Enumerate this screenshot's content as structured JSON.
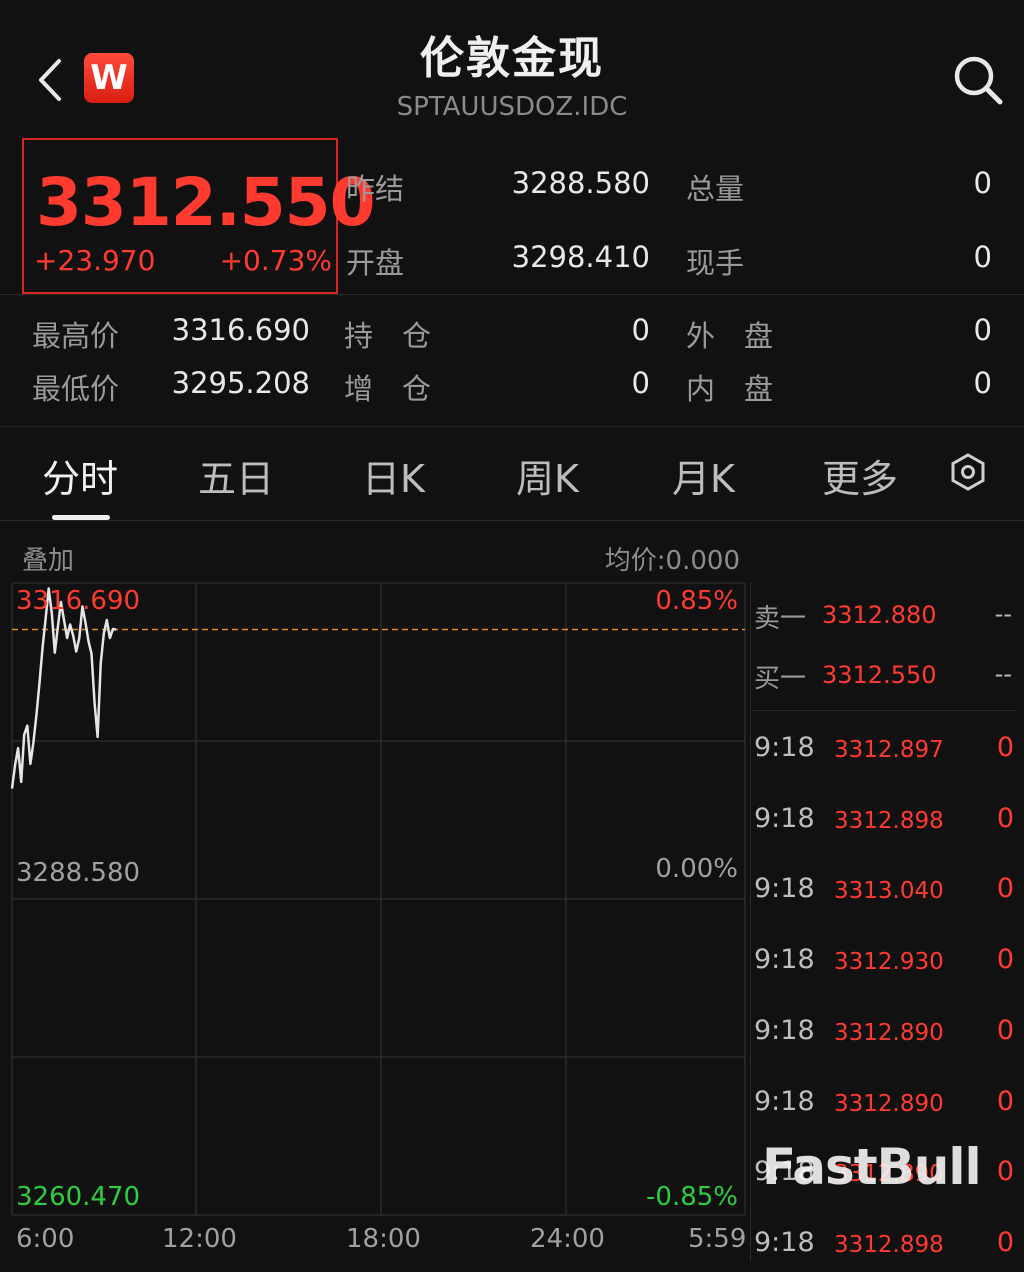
{
  "header": {
    "title": "伦敦金现",
    "subtitle": "SPTAUUSDOZ.IDC",
    "badge": "W"
  },
  "quote": {
    "price": "3312.550",
    "change": "+23.970",
    "change_pct": "+0.73%"
  },
  "stats": {
    "prev_settle_label": "昨结",
    "prev_settle": "3288.580",
    "open_label": "开盘",
    "open": "3298.410",
    "total_vol_label": "总量",
    "total_vol": "0",
    "cur_vol_label": "现手",
    "cur_vol": "0",
    "high_label": "最高价",
    "high": "3316.690",
    "low_label": "最低价",
    "low": "3295.208",
    "open_int_label": "持　仓",
    "open_int": "0",
    "inc_int_label": "增　仓",
    "inc_int": "0",
    "outer_label": "外　盘",
    "outer": "0",
    "inner_label": "内　盘",
    "inner": "0"
  },
  "tabs": [
    "分时",
    "五日",
    "日K",
    "周K",
    "月K",
    "更多"
  ],
  "chart_header": {
    "overlay": "叠加",
    "avg_price": "均价:0.000"
  },
  "chart_data": {
    "type": "line",
    "ylim": [
      3260.47,
      3316.69
    ],
    "y_ticks_left": [
      "3316.690",
      "3288.580",
      "3260.470"
    ],
    "y_ticks_right": [
      "0.85%",
      "0.00%",
      "-0.85%"
    ],
    "x_ticks": [
      "6:00",
      "12:00",
      "18:00",
      "24:00",
      "5:59"
    ],
    "reference_line": 3312.55,
    "series": [
      {
        "values": [
          3298.4,
          3300.5,
          3302.0,
          3299.0,
          3303.2,
          3304.0,
          3300.6,
          3302.5,
          3305.0,
          3307.8,
          3311.0,
          3313.5,
          3316.2,
          3314.0,
          3310.5,
          3312.8,
          3315.0,
          3313.4,
          3311.8,
          3313.0,
          3312.0,
          3310.6,
          3311.8,
          3314.6,
          3313.2,
          3311.5,
          3310.4,
          3306.0,
          3303.0,
          3309.5,
          3312.2,
          3313.4,
          3311.8,
          3312.6,
          3312.55
        ]
      }
    ]
  },
  "order_book": [
    {
      "label": "卖一",
      "price": "3312.880",
      "vol": "--"
    },
    {
      "label": "买一",
      "price": "3312.550",
      "vol": "--"
    }
  ],
  "ticks": [
    {
      "time": "9:18",
      "price": "3312.897",
      "vol": "0"
    },
    {
      "time": "9:18",
      "price": "3312.898",
      "vol": "0"
    },
    {
      "time": "9:18",
      "price": "3313.040",
      "vol": "0"
    },
    {
      "time": "9:18",
      "price": "3312.930",
      "vol": "0"
    },
    {
      "time": "9:18",
      "price": "3312.890",
      "vol": "0"
    },
    {
      "time": "9:18",
      "price": "3312.890",
      "vol": "0"
    },
    {
      "time": "9:18",
      "price": "3312.890",
      "vol": "0"
    },
    {
      "time": "9:18",
      "price": "3312.898",
      "vol": "0"
    }
  ],
  "watermark": "FastBull",
  "colors": {
    "up": "#ff3b30",
    "down": "#2ecc40",
    "line": "#e6e6e6",
    "ref_line": "#e08a2a"
  }
}
